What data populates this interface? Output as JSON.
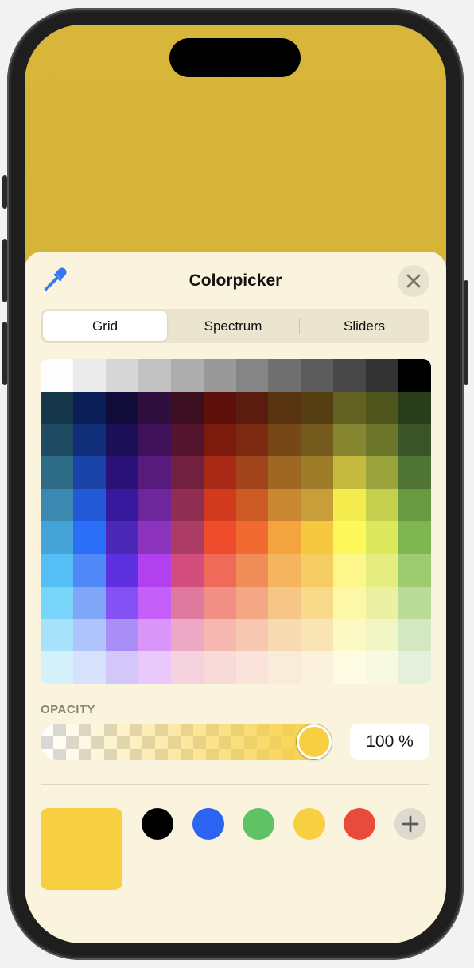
{
  "header": {
    "title": "Colorpicker",
    "eyedropper_icon": "eyedropper-icon",
    "close_icon": "close-icon"
  },
  "tabs": [
    {
      "label": "Grid",
      "active": true
    },
    {
      "label": "Spectrum",
      "active": false
    },
    {
      "label": "Sliders",
      "active": false
    }
  ],
  "grid_colors": [
    [
      "#fefefe",
      "#ebebeb",
      "#d6d6d6",
      "#c2c2c2",
      "#adadad",
      "#999999",
      "#858585",
      "#707070",
      "#5c5c5c",
      "#474747",
      "#333333",
      "#000000"
    ],
    [
      "#16384a",
      "#0a1d55",
      "#110c3a",
      "#2d0e3c",
      "#3b0f1f",
      "#5c1009",
      "#5a1c0e",
      "#583410",
      "#553f12",
      "#646222",
      "#4f561d",
      "#2b3e1b"
    ],
    [
      "#1e4b61",
      "#112f79",
      "#1b0f58",
      "#3f1158",
      "#54142d",
      "#7a1b0e",
      "#7c2b12",
      "#764817",
      "#745a1c",
      "#878631",
      "#6c762b",
      "#3b5328"
    ],
    [
      "#2d6b87",
      "#1943a6",
      "#2a1278",
      "#571b7c",
      "#72203f",
      "#a72916",
      "#a2441b",
      "#9e6623",
      "#9d7d2a",
      "#c4ba3e",
      "#9ba43c",
      "#4f7434"
    ],
    [
      "#3b89b0",
      "#2159d7",
      "#37199e",
      "#6e269b",
      "#902d52",
      "#d23a1e",
      "#cc5a25",
      "#c98732",
      "#c79e3a",
      "#f4ec4c",
      "#c4d04d",
      "#679a43"
    ],
    [
      "#46a3d8",
      "#2b6ef7",
      "#4b28b8",
      "#8c34bd",
      "#ad3c65",
      "#ef4c2d",
      "#f06a31",
      "#f4a43f",
      "#f6c842",
      "#fdf95c",
      "#dde95d",
      "#7fb652"
    ],
    [
      "#54bff4",
      "#5088f7",
      "#5e31e0",
      "#b141ee",
      "#d24d7b",
      "#ef6a59",
      "#f08c57",
      "#f5b55f",
      "#f6cd63",
      "#fdf68a",
      "#e5ed80",
      "#9dcc70"
    ],
    [
      "#78d4f8",
      "#80a6f8",
      "#8451f5",
      "#c460f9",
      "#df7a9f",
      "#f28f84",
      "#f4a886",
      "#f6c686",
      "#f8da8a",
      "#fdf7a8",
      "#ebf0a2",
      "#bbdc99"
    ],
    [
      "#a7e2fa",
      "#afc4fa",
      "#aa8ef7",
      "#d996f8",
      "#eca8c4",
      "#f5b7b0",
      "#f6c7b1",
      "#f7dab2",
      "#f9e5b4",
      "#fdf9c5",
      "#f2f5c5",
      "#d3e7c0"
    ],
    [
      "#d4f0fb",
      "#d6e1fb",
      "#d3c7f9",
      "#e9c9fb",
      "#f4d3df",
      "#f8dbd8",
      "#f9e3db",
      "#faecda",
      "#fbf1dc",
      "#fdfbe2",
      "#f7f9e1",
      "#e5f0dc"
    ]
  ],
  "opacity": {
    "label": "OPACITY",
    "value_text": "100 %",
    "fraction": 1.0,
    "color": "#f8cf40"
  },
  "current_color": "#f8cf40",
  "saved_colors": [
    "#000000",
    "#2b63f2",
    "#5fc264",
    "#f8cf40",
    "#e84a3b"
  ],
  "add_icon": "plus-icon",
  "accent_color": "#3478f6",
  "wallpaper_color": "#d6b338"
}
